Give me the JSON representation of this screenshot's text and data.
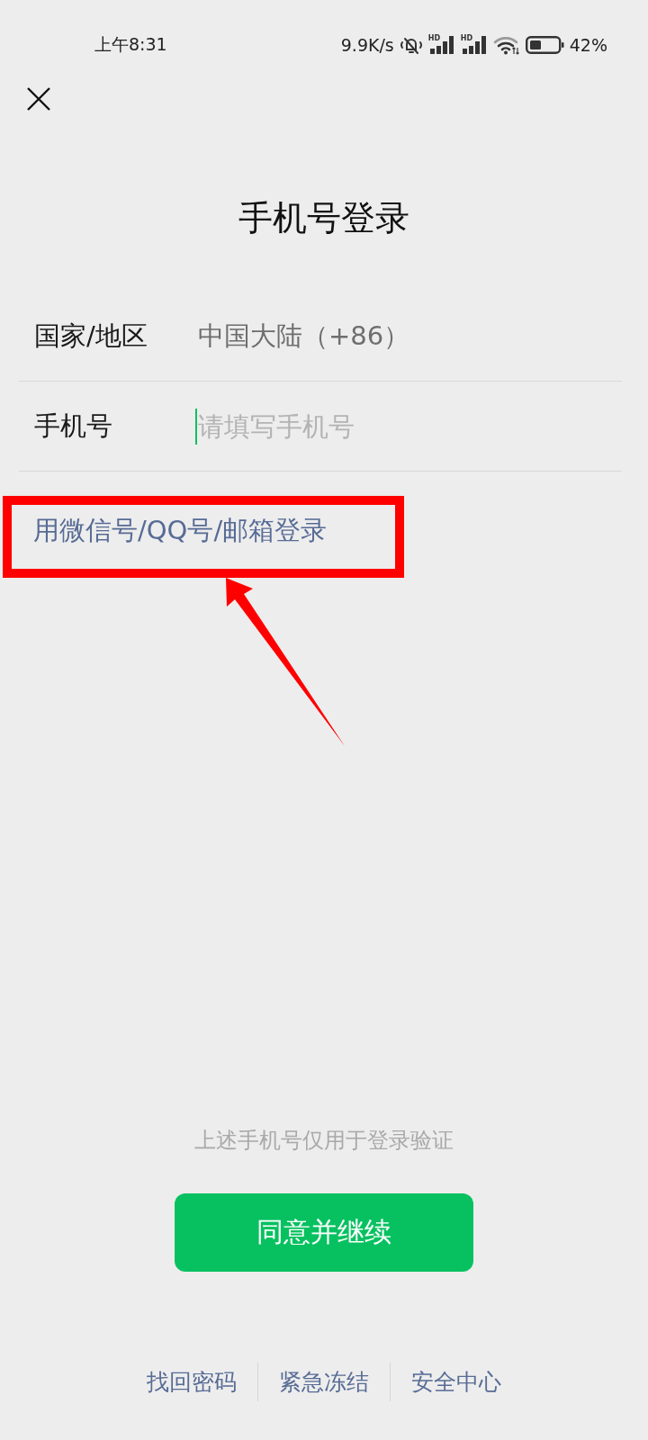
{
  "status_bar": {
    "time": "上午8:31",
    "net_speed": "9.9K/s",
    "signals": [
      {
        "label": "HD"
      },
      {
        "label": "HD"
      }
    ],
    "battery_text": "42%"
  },
  "title": "手机号登录",
  "form": {
    "rows": [
      {
        "kind": "select",
        "label": "国家/地区",
        "value": "中国大陆（+86）"
      },
      {
        "kind": "input",
        "label": "手机号",
        "placeholder": "请填写手机号",
        "focused": true
      }
    ]
  },
  "alt_login": {
    "text": "用微信号/QQ号/邮箱登录",
    "highlighted": true
  },
  "notice": "上述手机号仅用于登录验证",
  "primary_button": "同意并继续",
  "footer_links": [
    "找回密码",
    "紧急冻结",
    "安全中心"
  ]
}
